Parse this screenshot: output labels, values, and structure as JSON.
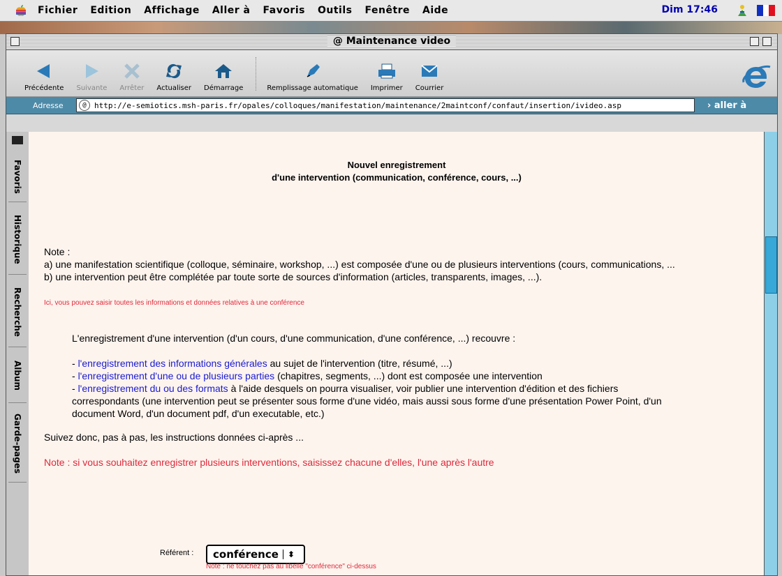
{
  "menubar": {
    "items": [
      "Fichier",
      "Edition",
      "Affichage",
      "Aller à",
      "Favoris",
      "Outils",
      "Fenêtre",
      "Aide"
    ],
    "clock": "Dim 17:46"
  },
  "window": {
    "title": "Maintenance video"
  },
  "toolbar": {
    "back": "Précédente",
    "forward": "Suivante",
    "stop": "Arrêter",
    "refresh": "Actualiser",
    "home": "Démarrage",
    "autofill": "Remplissage automatique",
    "print": "Imprimer",
    "mail": "Courrier"
  },
  "address": {
    "label": "Adresse",
    "url": "http://e-semiotics.msh-paris.fr/opales/colloques/manifestation/maintenance/2maintconf/confaut/insertion/ivideo.asp",
    "go": "aller à"
  },
  "sidetabs": [
    "Favoris",
    "Historique",
    "Recherche",
    "Album",
    "Garde-pages"
  ],
  "page": {
    "title_line1": "Nouvel enregistrement",
    "title_line2": "d'une intervention (communication, conférence, cours, ...)",
    "note_label": "Note :",
    "note_a": "a) une manifestation scientifique (colloque, séminaire, workshop, ...) est composée d'une ou de plusieurs interventions (cours, communications, ...",
    "note_b": "b) une intervention peut être complétée par toute sorte de sources d'information (articles, transparents, images, ...).",
    "info_red": "Ici, vous pouvez saisir toutes les informations et données relatives à une conférence",
    "intro": "L'enregistrement d'une intervention (d'un cours, d'une communication, d'une conférence, ...) recouvre :",
    "item1_prefix": "- ",
    "item1_link": "l'enregistrement des informations générales",
    "item1_rest": " au sujet de l'intervention (titre, résumé, ...)",
    "item2_prefix": "- ",
    "item2_link": "l'enregistrement d'une ou de plusieurs parties",
    "item2_rest": " (chapitres, segments, ...) dont est composée une intervention",
    "item3_prefix": "- ",
    "item3_link": "l'enregistrement du ou des formats",
    "item3_rest": " à l'aide desquels on pourra visualiser, voir publier une intervention d'édition et des fichiers",
    "item3_line2": "correspondants (une intervention peut se présenter sous forme d'une vidéo, mais aussi sous forme d'une présentation Power Point, d'un",
    "item3_line3": "document Word, d'un document pdf, d'un executable, etc.)",
    "follow": "Suivez donc, pas à pas, les instructions données ci-après ...",
    "note_red": "Note : si vous souhaitez enregistrer plusieurs interventions, saisissez chacune d'elles, l'une après l'autre",
    "referent_label": "Référent :",
    "referent_value": "conférence",
    "referent_note": "Note : ne touchez pas au libellé \"conférence\" ci-dessus"
  }
}
